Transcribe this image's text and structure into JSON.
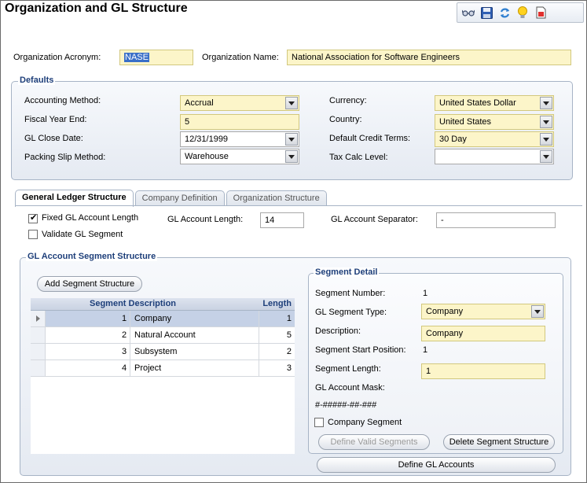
{
  "page": {
    "title": "Organization and GL Structure"
  },
  "toolbar": {
    "icons": [
      "glasses-icon",
      "save-icon",
      "refresh-icon",
      "lightbulb-icon",
      "report-icon"
    ]
  },
  "org": {
    "acronym_label": "Organization Acronym:",
    "acronym_value": "NASE",
    "name_label": "Organization Name:",
    "name_value": "National Association for Software Engineers"
  },
  "defaults": {
    "title": "Defaults",
    "accounting_method_label": "Accounting Method:",
    "accounting_method_value": "Accrual",
    "fiscal_year_end_label": "Fiscal Year End:",
    "fiscal_year_end_value": "5",
    "gl_close_date_label": "GL Close Date:",
    "gl_close_date_value": "12/31/1999",
    "packing_slip_label": "Packing Slip Method:",
    "packing_slip_value": "Warehouse",
    "currency_label": "Currency:",
    "currency_value": "United States Dollar",
    "country_label": "Country:",
    "country_value": "United States",
    "credit_terms_label": "Default Credit Terms:",
    "credit_terms_value": "30 Day",
    "tax_calc_label": "Tax Calc Level:",
    "tax_calc_value": ""
  },
  "tabs": [
    {
      "label": "General Ledger Structure"
    },
    {
      "label": "Company Definition"
    },
    {
      "label": "Organization Structure"
    }
  ],
  "gl": {
    "fixed_length_label": "Fixed GL Account Length",
    "validate_segment_label": "Validate GL Segment",
    "account_length_label": "GL Account Length:",
    "account_length_value": "14",
    "separator_label": "GL Account Separator:",
    "separator_value": "-"
  },
  "segment_structure": {
    "title": "GL Account Segment Structure",
    "add_button": "Add Segment Structure",
    "col_description": "Segment Description",
    "col_length": "Length",
    "rows": [
      {
        "num": "1",
        "desc": "Company",
        "length": "1"
      },
      {
        "num": "2",
        "desc": "Natural Account",
        "length": "5"
      },
      {
        "num": "3",
        "desc": "Subsystem",
        "length": "2"
      },
      {
        "num": "4",
        "desc": "Project",
        "length": "3"
      }
    ]
  },
  "segment_detail": {
    "title": "Segment Detail",
    "number_label": "Segment Number:",
    "number_value": "1",
    "type_label": "GL Segment Type:",
    "type_value": "Company",
    "description_label": "Description:",
    "description_value": "Company",
    "start_label": "Segment Start Position:",
    "start_value": "1",
    "length_label": "Segment Length:",
    "length_value": "1",
    "mask_label": "GL Account Mask:",
    "mask_value": "#-#####-##-###",
    "company_segment_label": "Company Segment",
    "define_valid_button": "Define Valid Segments",
    "delete_button": "Delete Segment Structure"
  },
  "define_gl_button": "Define GL Accounts"
}
